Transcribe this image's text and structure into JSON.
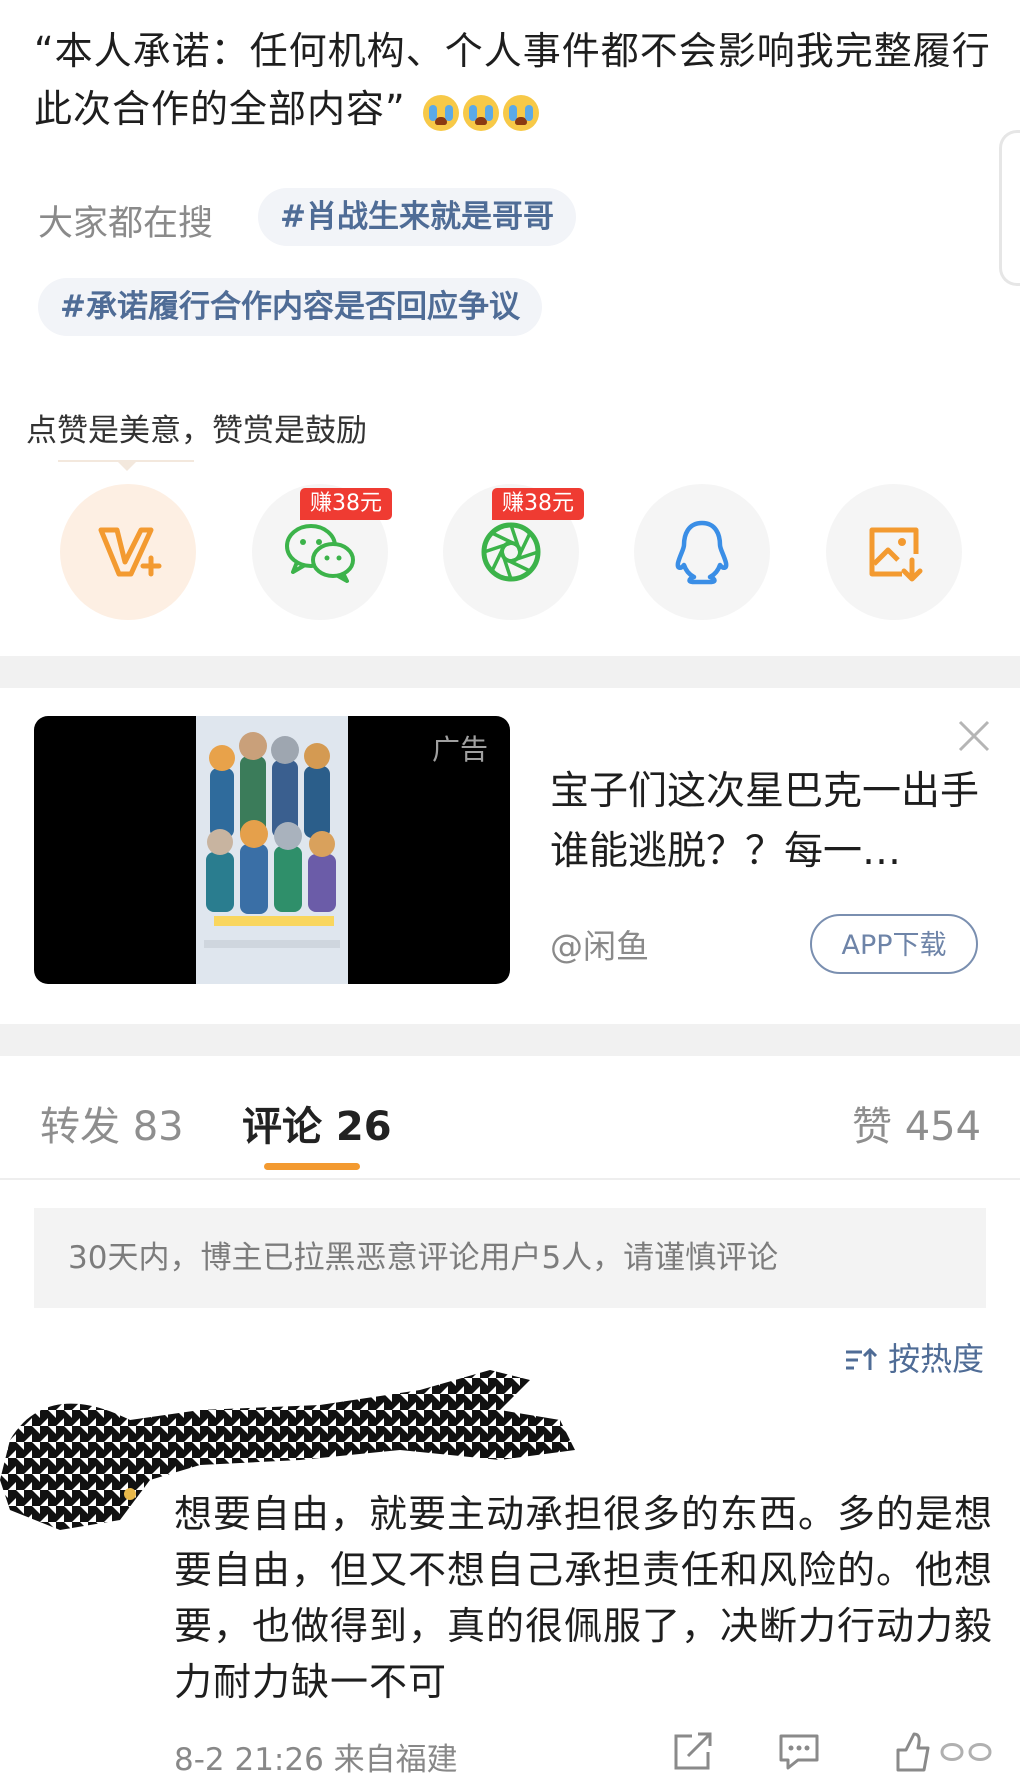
{
  "post": {
    "text": "“本人承诺：任何机构、个人事件都不会影响我完整履行此次合作的全部内容”",
    "emojis": [
      "crying-emoji",
      "crying-emoji",
      "crying-emoji"
    ]
  },
  "hot_search": {
    "label": "大家都在搜",
    "tags": [
      "#肖战生来就是哥哥",
      "#承诺履行合作内容是否回应争议"
    ]
  },
  "reward": {
    "tip": "点赞是美意，赞赏是鼓励",
    "buttons": [
      {
        "icon": "v-plus-icon",
        "badge": ""
      },
      {
        "icon": "wechat-icon",
        "badge": "赚38元"
      },
      {
        "icon": "moments-icon",
        "badge": "赚38元"
      },
      {
        "icon": "qq-icon",
        "badge": ""
      },
      {
        "icon": "save-image-icon",
        "badge": ""
      }
    ]
  },
  "ad": {
    "label": "广告",
    "title": "宝子们这次星巴克一出手谁能逃脱？？每一…",
    "source": "@闲鱼",
    "button": "APP下载"
  },
  "tabs": {
    "repost": "转发 83",
    "comments": "评论 26",
    "likes": "赞 454"
  },
  "notice": "30天内，博主已拉黑恶意评论用户5人，请谨慎评论",
  "sort": {
    "icon": "sort-icon",
    "label": "按热度"
  },
  "comment": {
    "text": "想要自由，就要主动承担很多的东西。多的是想要自由，但又不想自己承担责任和风险的。他想要，也做得到，真的很佩服了，决断力行动力毅力耐力缺一不可",
    "meta": "8-2 21:26 来自福建"
  },
  "colors": {
    "accent_orange": "#f39a30",
    "link_blue": "#4f6c96",
    "badge_red": "#ef3b32",
    "wechat_green": "#3cb34a",
    "qq_blue": "#3a8ee6"
  }
}
